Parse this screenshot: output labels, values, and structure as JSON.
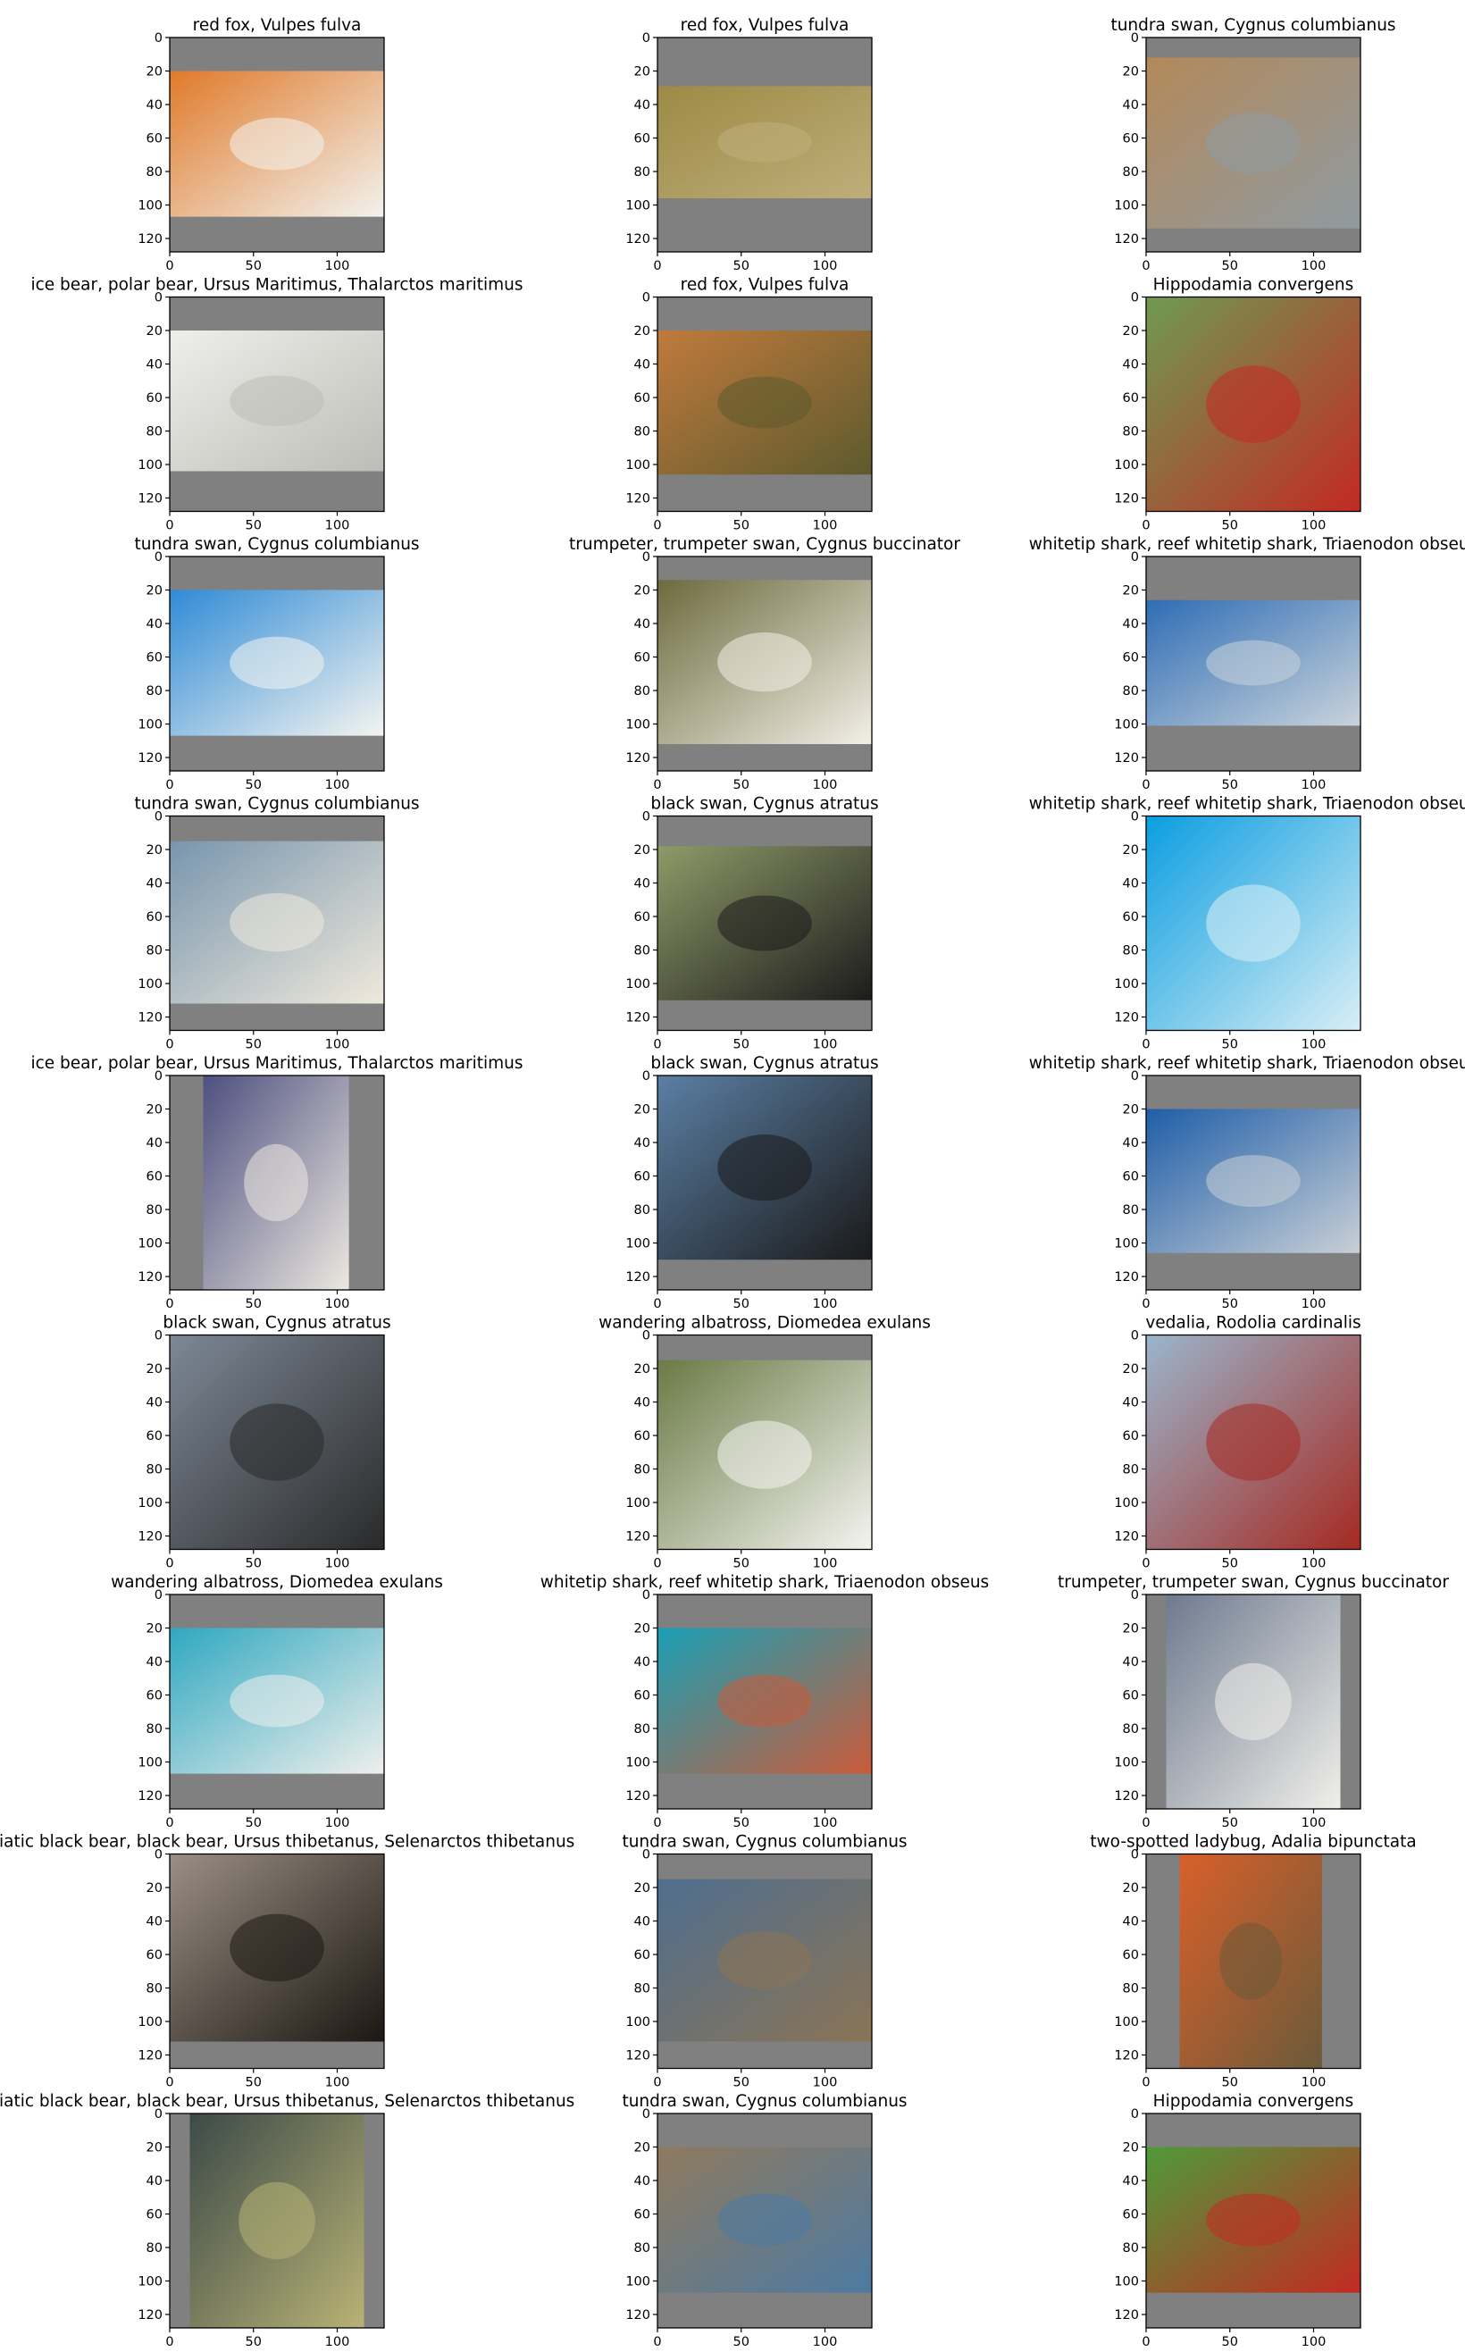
{
  "figure": {
    "background": "#ffffff",
    "pad_color": "#808080"
  },
  "chart_data": {
    "type": "image_grid",
    "rows": 9,
    "cols": 3,
    "xlim": [
      0,
      128
    ],
    "ylim": [
      128,
      0
    ],
    "xticks": [
      0,
      50,
      100
    ],
    "yticks": [
      0,
      20,
      40,
      60,
      80,
      100,
      120
    ],
    "panels": [
      {
        "title": "red fox, Vulpes fulva",
        "image": "red fox running on snow",
        "colors": [
          "#e07a2a",
          "#f2f2ee"
        ],
        "content_rows": [
          20,
          107
        ],
        "content_cols": [
          0,
          128
        ]
      },
      {
        "title": "red fox, Vulpes fulva",
        "image": "red fox lying in grass",
        "colors": [
          "#9c8a45",
          "#bfae7a"
        ],
        "content_rows": [
          29,
          96
        ],
        "content_cols": [
          0,
          128
        ]
      },
      {
        "title": "tundra swan, Cygnus columbianus",
        "image": "swan on a lake with reeds",
        "colors": [
          "#b3895a",
          "#8f9aa0"
        ],
        "content_rows": [
          12,
          114
        ],
        "content_cols": [
          0,
          128
        ]
      },
      {
        "title": "ice bear, polar bear, Ursus Maritimus, Thalarctos maritimus",
        "image": "polar bear portrait",
        "colors": [
          "#eeeeea",
          "#bdbdb8"
        ],
        "content_rows": [
          20,
          104
        ],
        "content_cols": [
          0,
          128
        ]
      },
      {
        "title": "red fox, Vulpes fulva",
        "image": "red fox eating",
        "colors": [
          "#c07a3c",
          "#5d5a2e"
        ],
        "content_rows": [
          20,
          106
        ],
        "content_cols": [
          0,
          128
        ]
      },
      {
        "title": "Hippodamia convergens",
        "image": "ladybug on green leaf",
        "colors": [
          "#6f9a52",
          "#c22a22"
        ],
        "content_rows": [
          0,
          128
        ],
        "content_cols": [
          0,
          128
        ]
      },
      {
        "title": "tundra swan, Cygnus columbianus",
        "image": "swan flying in blue sky",
        "colors": [
          "#2f8bd6",
          "#f4f4f0"
        ],
        "content_rows": [
          20,
          107
        ],
        "content_cols": [
          0,
          128
        ]
      },
      {
        "title": "trumpeter, trumpeter swan, Cygnus buccinator",
        "image": "white swan on green water",
        "colors": [
          "#6d6a3e",
          "#f2efe6"
        ],
        "content_rows": [
          14,
          112
        ],
        "content_cols": [
          0,
          128
        ]
      },
      {
        "title": "whitetip shark, reef whitetip shark, Triaenodon obseus",
        "image": "shark underwater",
        "colors": [
          "#2f6db5",
          "#c9d3db"
        ],
        "content_rows": [
          26,
          101
        ],
        "content_cols": [
          0,
          128
        ]
      },
      {
        "title": "tundra swan, Cygnus columbianus",
        "image": "swan on blue water",
        "colors": [
          "#7895ad",
          "#efe9dc"
        ],
        "content_rows": [
          15,
          112
        ],
        "content_cols": [
          0,
          128
        ]
      },
      {
        "title": "black swan, Cygnus atratus",
        "image": "black swan with frame",
        "colors": [
          "#8f9a68",
          "#1c1c1c"
        ],
        "content_rows": [
          18,
          110
        ],
        "content_cols": [
          0,
          128
        ]
      },
      {
        "title": "whitetip shark, reef whitetip shark, Triaenodon obseus",
        "image": "shark in bright blue water",
        "colors": [
          "#0b9ee0",
          "#d8eef6"
        ],
        "content_rows": [
          0,
          128
        ],
        "content_cols": [
          0,
          128
        ]
      },
      {
        "title": "ice bear, polar bear, Ursus Maritimus, Thalarctos maritimus",
        "image": "two polar bears standing",
        "colors": [
          "#4d4f7f",
          "#ece8e0"
        ],
        "content_rows": [
          0,
          128
        ],
        "content_cols": [
          20,
          107
        ]
      },
      {
        "title": "black swan, Cygnus atratus",
        "image": "black swan near pond",
        "colors": [
          "#5b7fa4",
          "#1a1a1a"
        ],
        "content_rows": [
          0,
          110
        ],
        "content_cols": [
          0,
          128
        ]
      },
      {
        "title": "whitetip shark, reef whitetip shark, Triaenodon obseus",
        "image": "shark close up",
        "colors": [
          "#1f5ea8",
          "#c8cfd6"
        ],
        "content_rows": [
          20,
          106
        ],
        "content_cols": [
          0,
          128
        ]
      },
      {
        "title": "black swan, Cygnus atratus",
        "image": "black swan on water",
        "colors": [
          "#7d8896",
          "#2a2a2a"
        ],
        "content_rows": [
          0,
          128
        ],
        "content_cols": [
          0,
          128
        ]
      },
      {
        "title": "wandering albatross, Diomedea exulans",
        "image": "albatross spreading wings",
        "colors": [
          "#6b7a45",
          "#f4f4f0"
        ],
        "content_rows": [
          15,
          128
        ],
        "content_cols": [
          0,
          128
        ]
      },
      {
        "title": "vedalia, Rodolia cardinalis",
        "image": "ladybug on branch",
        "colors": [
          "#9ab5cc",
          "#a52a22"
        ],
        "content_rows": [
          0,
          128
        ],
        "content_cols": [
          0,
          128
        ]
      },
      {
        "title": "wandering albatross, Diomedea exulans",
        "image": "albatross colony",
        "colors": [
          "#2fa8c0",
          "#efefec"
        ],
        "content_rows": [
          20,
          107
        ],
        "content_cols": [
          0,
          128
        ]
      },
      {
        "title": "whitetip shark, reef whitetip shark, Triaenodon obseus",
        "image": "shark over reef",
        "colors": [
          "#1aa0b5",
          "#c95a3a"
        ],
        "content_rows": [
          20,
          107
        ],
        "content_cols": [
          0,
          128
        ]
      },
      {
        "title": "trumpeter, trumpeter swan, Cygnus buccinator",
        "image": "swan preening",
        "colors": [
          "#6e7a8f",
          "#f0efea"
        ],
        "content_rows": [
          0,
          128
        ],
        "content_cols": [
          12,
          116
        ]
      },
      {
        "title": "Asiatic black bear, black bear, Ursus thibetanus, Selenarctos thibetanus",
        "image": "black bear on rocks",
        "colors": [
          "#9a8f84",
          "#1c1712"
        ],
        "content_rows": [
          0,
          112
        ],
        "content_cols": [
          0,
          128
        ]
      },
      {
        "title": "tundra swan, Cygnus columbianus",
        "image": "swans on shoreline",
        "colors": [
          "#4f6e8f",
          "#8a7455"
        ],
        "content_rows": [
          15,
          112
        ],
        "content_cols": [
          0,
          128
        ]
      },
      {
        "title": "two-spotted ladybug, Adalia bipunctata",
        "image": "ladybug on leaves",
        "colors": [
          "#d8602a",
          "#6b5a3a"
        ],
        "content_rows": [
          0,
          128
        ],
        "content_cols": [
          20,
          105
        ]
      },
      {
        "title": "Asiatic black bear, black bear, Ursus thibetanus, Selenarctos thibetanus",
        "image": "black bear in frame",
        "colors": [
          "#3c4a48",
          "#b8b275"
        ],
        "content_rows": [
          0,
          128
        ],
        "content_cols": [
          12,
          116
        ]
      },
      {
        "title": "tundra swan, Cygnus columbianus",
        "image": "swans on marsh",
        "colors": [
          "#8f7a5e",
          "#4d7aa2"
        ],
        "content_rows": [
          20,
          107
        ],
        "content_cols": [
          0,
          128
        ]
      },
      {
        "title": "Hippodamia convergens",
        "image": "ladybug on green leaf",
        "colors": [
          "#4f9a3a",
          "#c22a22"
        ],
        "content_rows": [
          20,
          107
        ],
        "content_cols": [
          0,
          128
        ]
      }
    ]
  }
}
